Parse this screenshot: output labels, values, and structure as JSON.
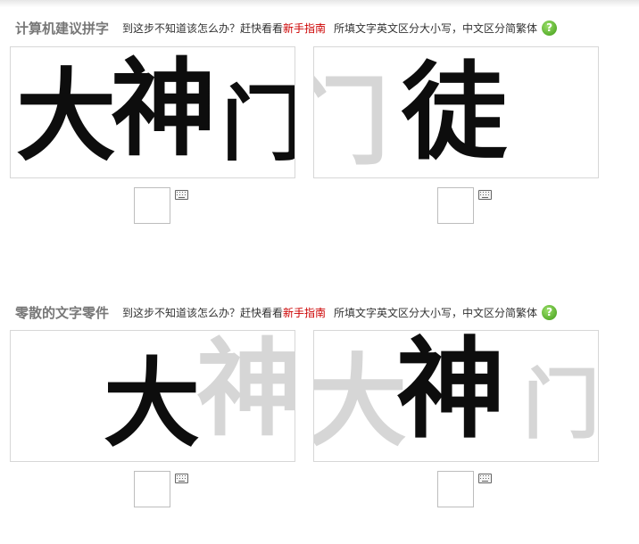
{
  "hint_prefix": "到这步不知道该怎么办？赶快看看",
  "guide_link": "新手指南",
  "case_note": "所填文字英文区分大小写，中文区分简繁体",
  "help_symbol": "?",
  "section1": {
    "title": "计算机建议拼字",
    "card_left": {
      "chars": [
        "大",
        "神",
        "门"
      ]
    },
    "card_right": {
      "ghost": "门",
      "char": "徒"
    }
  },
  "section2": {
    "title": "零散的文字零件",
    "card_left": {
      "char": "大",
      "ghost": "神"
    },
    "card_right": {
      "ghost_left": "大",
      "char": "神",
      "ghost_right": "门"
    }
  }
}
